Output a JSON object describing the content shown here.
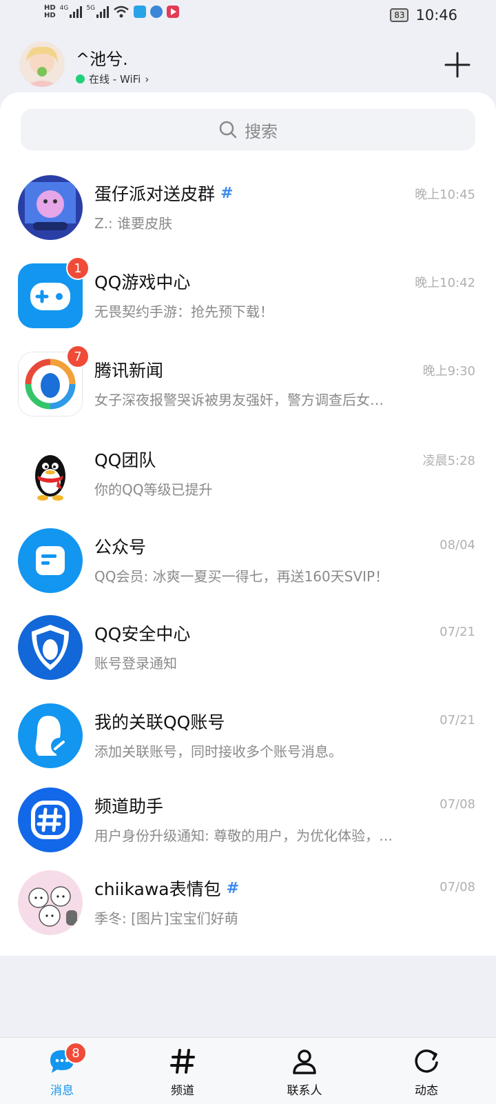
{
  "status": {
    "hd1": "HD",
    "hd2": "HD",
    "net1": "4G",
    "net2": "5G",
    "battery": "83",
    "time": "10:46"
  },
  "header": {
    "username": "^池兮.",
    "status": "在线 - WiFi",
    "chevron": "›"
  },
  "search": {
    "placeholder": "搜索"
  },
  "chats": [
    {
      "title": "蛋仔派对送皮群",
      "message": "Z.: 谁要皮肤",
      "time": "晚上10:45",
      "icon": "group-avatar",
      "hash": "#"
    },
    {
      "title": "QQ游戏中心",
      "message": "无畏契约手游：抢先预下载！",
      "time": "晚上10:42",
      "icon": "gamepad-icon",
      "badge": "1"
    },
    {
      "title": "腾讯新闻",
      "message": "女子深夜报警哭诉被男友强奸，警方调查后女…",
      "time": "晚上9:30",
      "icon": "tencent-news-icon",
      "badge": "7"
    },
    {
      "title": "QQ团队",
      "message": "你的QQ等级已提升",
      "time": "凌晨5:28",
      "icon": "qq-penguin-icon"
    },
    {
      "title": "公众号",
      "message": "QQ会员: 冰爽一夏买一得七，再送160天SVIP！",
      "time": "08/04",
      "icon": "official-account-icon"
    },
    {
      "title": "QQ安全中心",
      "message": "账号登录通知",
      "time": "07/21",
      "icon": "security-shield-icon"
    },
    {
      "title": "我的关联QQ账号",
      "message": "添加关联账号，同时接收多个账号消息。",
      "time": "07/21",
      "icon": "linked-account-icon"
    },
    {
      "title": "频道助手",
      "message": "用户身份升级通知: 尊敬的用户，为优化体验，…",
      "time": "07/08",
      "icon": "channel-helper-icon"
    },
    {
      "title": "chiikawa表情包",
      "message": "季冬: [图片]宝宝们好萌",
      "time": "07/08",
      "icon": "chiikawa-avatar",
      "hash": "#"
    }
  ],
  "tabs": [
    {
      "label": "消息",
      "icon": "message-icon",
      "badge": "8"
    },
    {
      "label": "频道",
      "icon": "hash-icon"
    },
    {
      "label": "联系人",
      "icon": "contacts-icon"
    },
    {
      "label": "动态",
      "icon": "moments-icon"
    }
  ],
  "colors": {
    "accent": "#1296f0",
    "badge": "#f04b38",
    "online": "#21d07a",
    "hash": "#3c8cf0"
  }
}
